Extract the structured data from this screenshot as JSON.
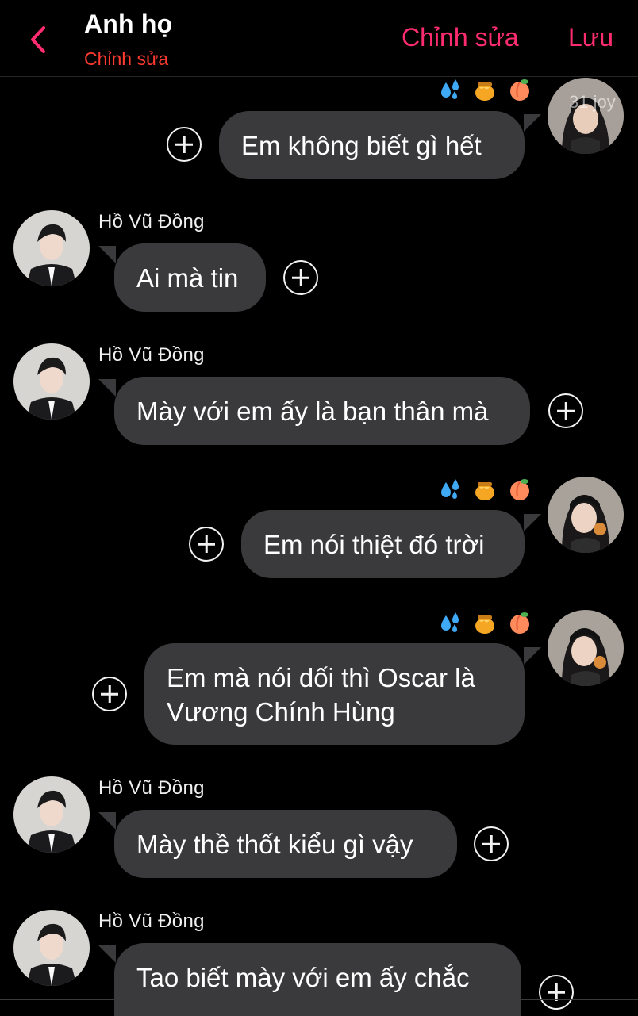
{
  "header": {
    "title": "Anh họ",
    "subtitle": "Chỉnh sửa",
    "edit_label": "Chỉnh sửa",
    "save_label": "Lưu"
  },
  "watermark": "31 joy",
  "messages": [
    {
      "side": "right",
      "text": "Em không biết gì hết"
    },
    {
      "side": "left",
      "sender": "Hồ Vũ Đồng",
      "text": "Ai mà tin"
    },
    {
      "side": "left",
      "sender": "Hồ Vũ Đồng",
      "text": "Mày với em ấy là bạn thân mà"
    },
    {
      "side": "right",
      "text": "Em nói thiệt đó trời"
    },
    {
      "side": "right",
      "text": "Em mà nói dối thì Oscar là Vương Chính Hùng"
    },
    {
      "side": "left",
      "sender": "Hồ Vũ Đồng",
      "text": "Mày thề thốt kiểu gì vậy"
    },
    {
      "side": "left",
      "sender": "Hồ Vũ Đồng",
      "text": "Tao biết mày với em ấy chắc"
    }
  ],
  "reaction_icons": [
    "sweat-drops-icon",
    "honey-pot-icon",
    "peach-icon"
  ],
  "colors": {
    "background": "#000000",
    "bubble": "#3a3a3c",
    "accent": "#ff2d6f",
    "subtitle": "#ff3b30"
  }
}
